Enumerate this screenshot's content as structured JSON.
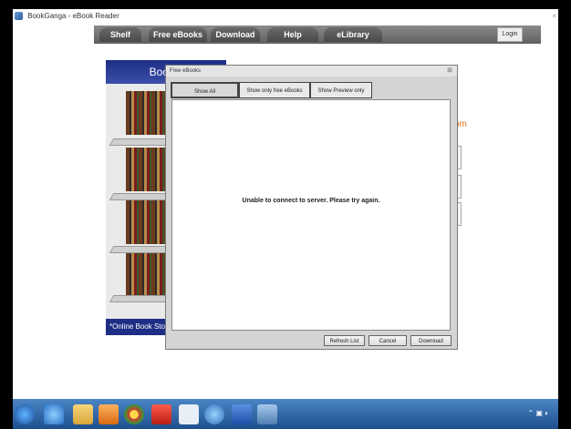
{
  "window": {
    "title": "BookGanga - eBook Reader"
  },
  "nav": {
    "tabs": [
      "Shelf",
      "Free eBooks",
      "Download",
      "Help",
      "eLibrary"
    ],
    "login_label": "Login"
  },
  "bookstore": {
    "header": "BookG",
    "footer": "*Online Book Store"
  },
  "side": {
    "text": "om"
  },
  "dialog": {
    "title": "Free eBooks",
    "tabs": [
      "Show All",
      "Show only free eBooks",
      "Show Preview only"
    ],
    "message": "Unable to connect to server. Please try again.",
    "buttons": {
      "refresh": "Refresh List",
      "cancel": "Cancel",
      "download": "Download"
    }
  },
  "taskbar": {
    "icons": [
      "windows-start-icon",
      "internet-explorer-icon",
      "file-explorer-icon",
      "media-player-icon",
      "chrome-icon",
      "acrobat-icon",
      "magnifier-icon",
      "network-icon",
      "word-icon",
      "image-viewer-icon"
    ],
    "tray": "⌃ ▣ ◐"
  },
  "colors": {
    "accent": "#1e2e86",
    "orange": "#e06a1a"
  }
}
